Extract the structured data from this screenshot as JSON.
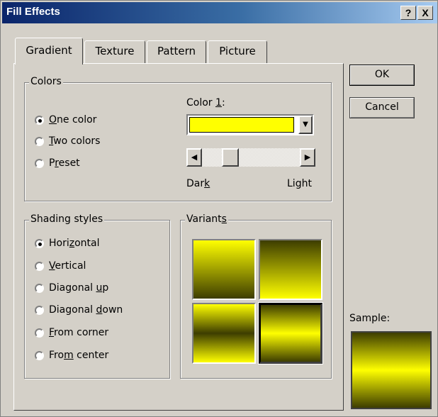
{
  "window": {
    "title": "Fill Effects",
    "help": "?",
    "close": "X"
  },
  "tabs": [
    {
      "label": "Gradient",
      "active": true
    },
    {
      "label": "Texture"
    },
    {
      "label": "Pattern"
    },
    {
      "label": "Picture"
    }
  ],
  "colors_group": {
    "legend": "Colors",
    "options": [
      {
        "pre": "",
        "key": "O",
        "post": "ne color",
        "checked": true
      },
      {
        "pre": "",
        "key": "T",
        "post": "wo colors"
      },
      {
        "pre": "P",
        "key": "r",
        "post": "eset"
      }
    ],
    "color1": {
      "pre": "Color ",
      "key": "1",
      "post": ":",
      "value": "#ffff00"
    },
    "slider": {
      "dark_pre": "Dar",
      "dark_key": "k",
      "light": "Light",
      "position": 0.45
    }
  },
  "shading_group": {
    "legend": "Shading styles",
    "options": [
      {
        "pre": "Hori",
        "key": "z",
        "post": "ontal",
        "checked": true
      },
      {
        "pre": "",
        "key": "V",
        "post": "ertical"
      },
      {
        "pre": "Diagonal ",
        "key": "u",
        "post": "p"
      },
      {
        "pre": "Diagonal ",
        "key": "d",
        "post": "own"
      },
      {
        "pre": "",
        "key": "F",
        "post": "rom corner"
      },
      {
        "pre": "Fro",
        "key": "m",
        "post": " center"
      }
    ]
  },
  "variants_group": {
    "pre": "Variant",
    "key": "s",
    "post": "",
    "selected": 3
  },
  "buttons": {
    "ok": "OK",
    "cancel": "Cancel"
  },
  "sample": {
    "label": "Sample:"
  },
  "colors": {
    "yellow": "#ffff00",
    "dark": "#3d3d00",
    "face": "#d4d0c8",
    "title_start": "#0a246a"
  }
}
